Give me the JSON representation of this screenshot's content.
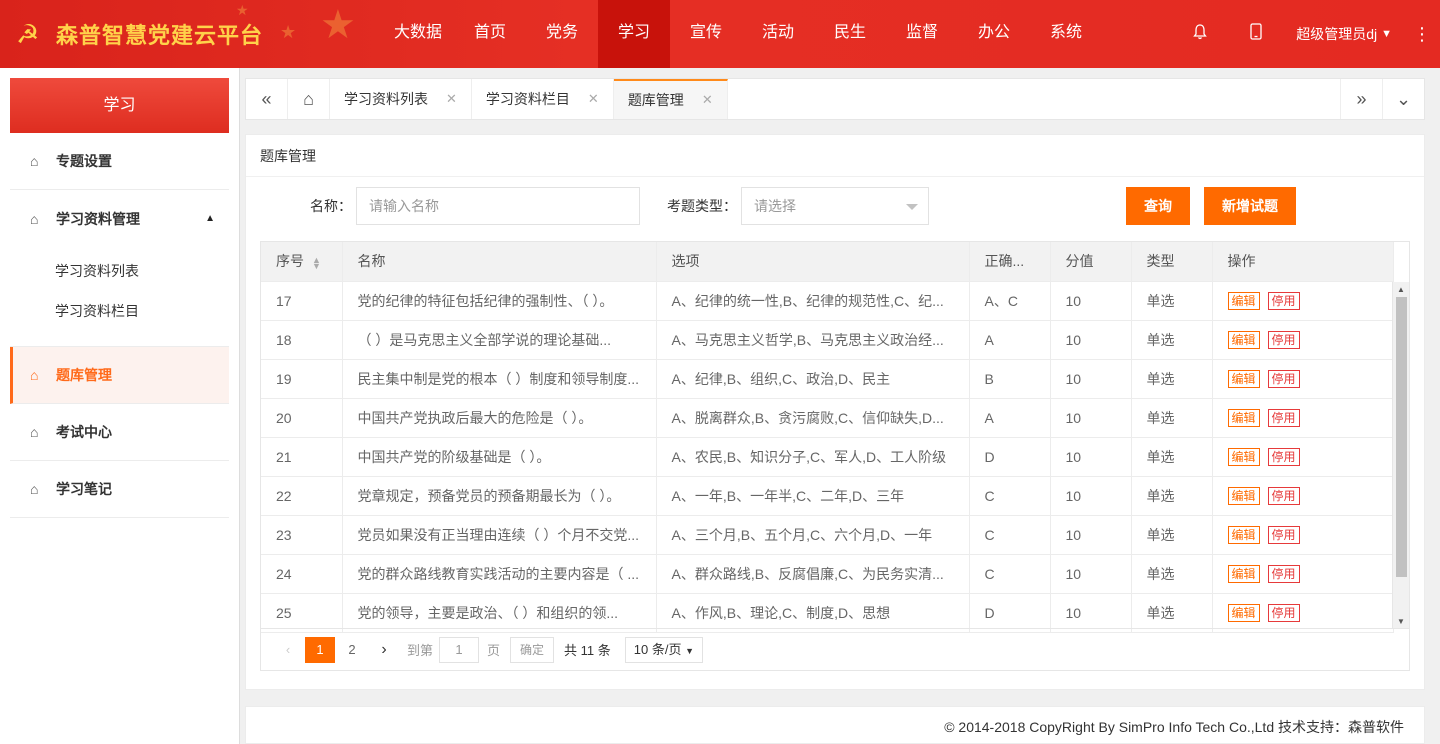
{
  "header": {
    "app_title": "森普智慧党建云平台",
    "nav": [
      {
        "label": "大数据",
        "active": false
      },
      {
        "label": "首页",
        "active": false
      },
      {
        "label": "党务",
        "active": false
      },
      {
        "label": "学习",
        "active": true
      },
      {
        "label": "宣传",
        "active": false
      },
      {
        "label": "活动",
        "active": false
      },
      {
        "label": "民生",
        "active": false
      },
      {
        "label": "监督",
        "active": false
      },
      {
        "label": "办公",
        "active": false
      },
      {
        "label": "系统",
        "active": false
      }
    ],
    "user_name": "超级管理员dj",
    "accent_color": "#e52f24",
    "logo_color": "#ffd24a"
  },
  "sidebar": {
    "title": "学习",
    "items": [
      {
        "label": "专题设置"
      },
      {
        "label": "学习资料管理",
        "expanded": true,
        "children": [
          "学习资料列表",
          "学习资料栏目"
        ]
      },
      {
        "label": "题库管理",
        "active": true
      },
      {
        "label": "考试中心"
      },
      {
        "label": "学习笔记"
      }
    ]
  },
  "tabs": [
    {
      "label": "学习资料列表",
      "active": false
    },
    {
      "label": "学习资料栏目",
      "active": false
    },
    {
      "label": "题库管理",
      "active": true
    }
  ],
  "panel": {
    "title": "题库管理",
    "name_label": "名称：",
    "name_placeholder": "请输入名称",
    "type_label": "考题类型：",
    "type_placeholder": "请选择",
    "query_button": "查询",
    "add_button": "新增试题",
    "button_color": "#ff6a00"
  },
  "table": {
    "columns": [
      "序号",
      "名称",
      "选项",
      "正确...",
      "分值",
      "类型",
      "操作"
    ],
    "edit_label": "编辑",
    "disable_label": "停用",
    "rows": [
      {
        "no": "17",
        "name": "党的纪律的特征包括纪律的强制性、（   ）。",
        "options": "A、纪律的统一性,B、纪律的规范性,C、纪...",
        "answer": "A、C",
        "score": "10",
        "type": "单选"
      },
      {
        "no": "18",
        "name": "（         ）是马克思主义全部学说的理论基础...",
        "options": "A、马克思主义哲学,B、马克思主义政治经...",
        "answer": "A",
        "score": "10",
        "type": "单选"
      },
      {
        "no": "19",
        "name": "民主集中制是党的根本（  ）制度和领导制度...",
        "options": "A、纪律,B、组织,C、政治,D、民主",
        "answer": "B",
        "score": "10",
        "type": "单选"
      },
      {
        "no": "20",
        "name": "中国共产党执政后最大的危险是（  ）。",
        "options": "A、脱离群众,B、贪污腐败,C、信仰缺失,D...",
        "answer": "A",
        "score": "10",
        "type": "单选"
      },
      {
        "no": "21",
        "name": "中国共产党的阶级基础是（           ）。",
        "options": "A、农民,B、知识分子,C、军人,D、工人阶级",
        "answer": "D",
        "score": "10",
        "type": "单选"
      },
      {
        "no": "22",
        "name": "党章规定，预备党员的预备期最长为（  ）。",
        "options": "A、一年,B、一年半,C、二年,D、三年",
        "answer": "C",
        "score": "10",
        "type": "单选"
      },
      {
        "no": "23",
        "name": "党员如果没有正当理由连续（  ）个月不交党...",
        "options": "A、三个月,B、五个月,C、六个月,D、一年",
        "answer": "C",
        "score": "10",
        "type": "单选"
      },
      {
        "no": "24",
        "name": "党的群众路线教育实践活动的主要内容是（   ...",
        "options": "A、群众路线,B、反腐倡廉,C、为民务实清...",
        "answer": "C",
        "score": "10",
        "type": "单选"
      },
      {
        "no": "25",
        "name": "党的领导，主要是政治、（      ）和组织的领...",
        "options": "A、作风,B、理论,C、制度,D、思想",
        "answer": "D",
        "score": "10",
        "type": "单选"
      }
    ]
  },
  "pagination": {
    "pages": [
      "1",
      "2"
    ],
    "current": "1",
    "goto_label": "到第",
    "goto_value": "1",
    "page_unit": "页",
    "confirm_label": "确定",
    "total_label": "共 11 条",
    "page_size_label": "10 条/页"
  },
  "footer": {
    "text": "© 2014-2018 CopyRight By SimPro Info Tech Co.,Ltd 技术支持：森普软件"
  }
}
